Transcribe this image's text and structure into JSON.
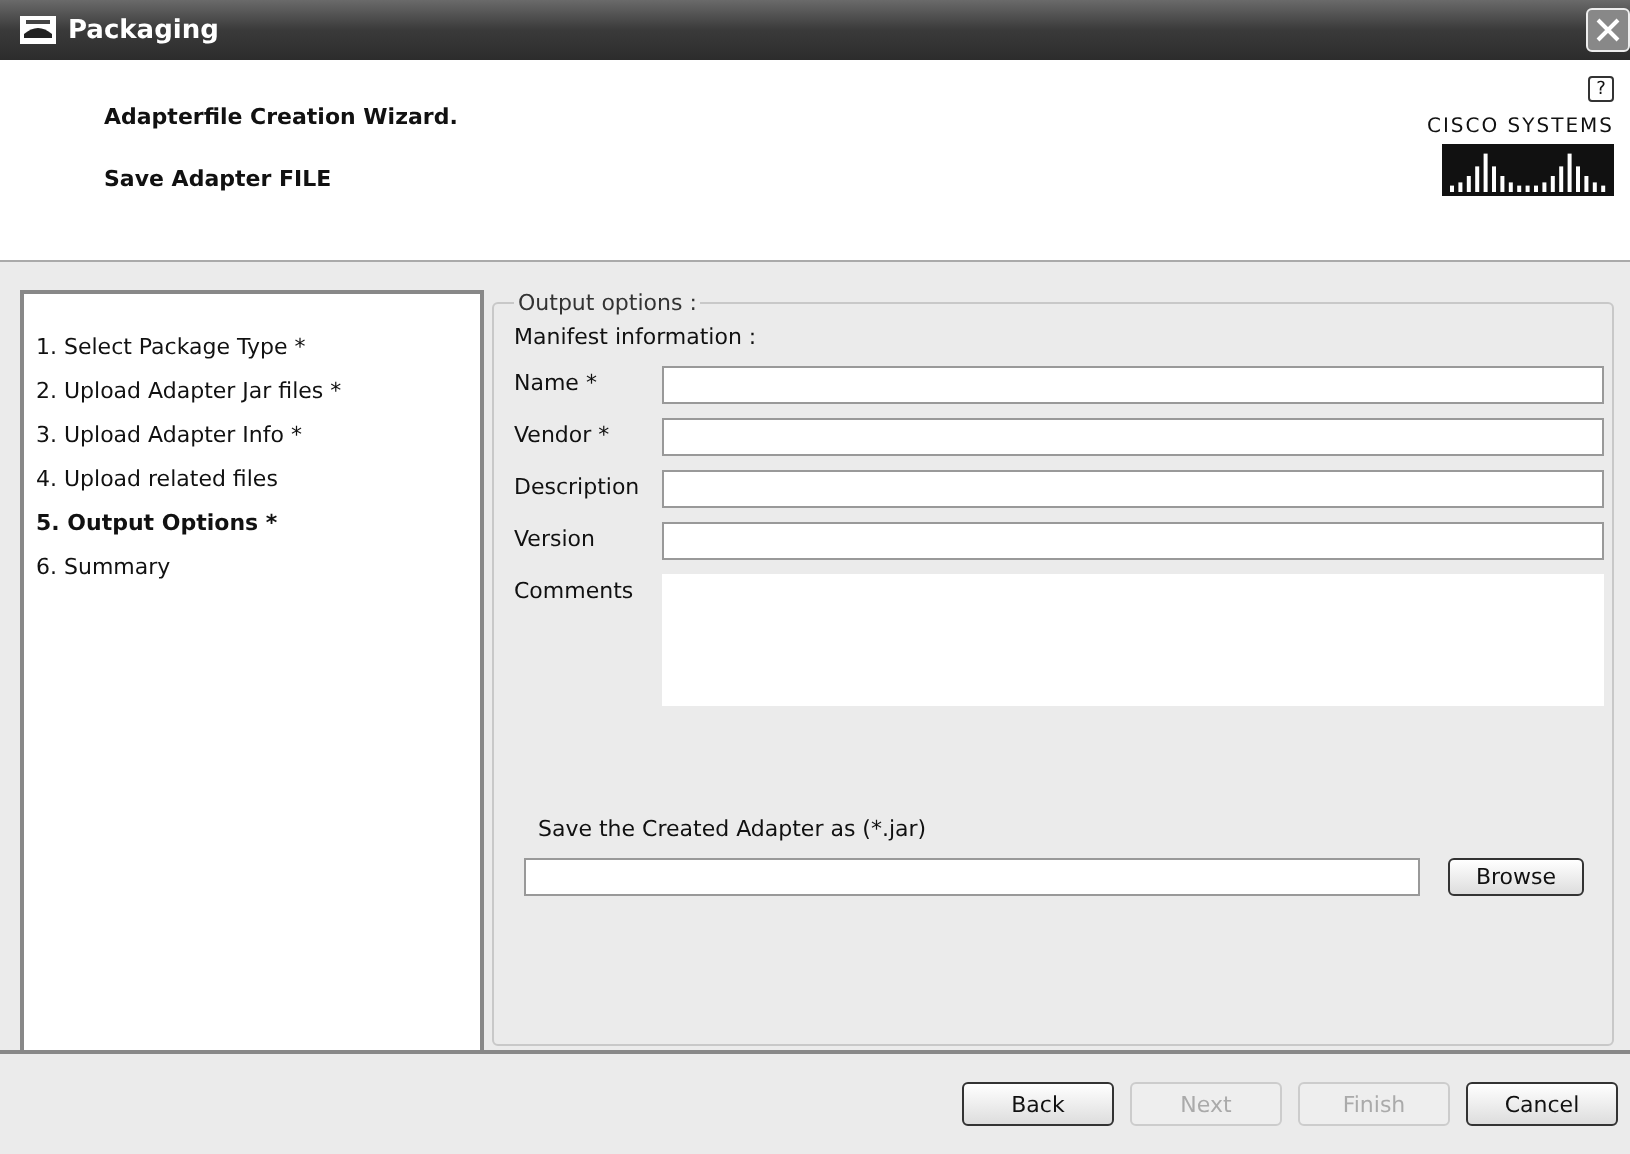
{
  "window": {
    "title": "Packaging"
  },
  "header": {
    "title": "Adapterfile Creation Wizard.",
    "subtitle": "Save Adapter FILE",
    "help": "?",
    "brand": "CISCO SYSTEMS"
  },
  "steps": [
    {
      "label": "1. Select Package Type *",
      "selected": false
    },
    {
      "label": "2. Upload Adapter Jar files *",
      "selected": false
    },
    {
      "label": "3. Upload Adapter Info *",
      "selected": false
    },
    {
      "label": "4. Upload related files",
      "selected": false
    },
    {
      "label": "5. Output Options *",
      "selected": true
    },
    {
      "label": "6. Summary",
      "selected": false
    }
  ],
  "output_options": {
    "legend": "Output options :",
    "section": "Manifest information :",
    "fields": [
      {
        "label": "Name *",
        "kind": "line"
      },
      {
        "label": "Vendor *",
        "kind": "line"
      },
      {
        "label": "Description",
        "kind": "line"
      },
      {
        "label": "Version",
        "kind": "line"
      },
      {
        "label": "Comments",
        "kind": "area"
      }
    ],
    "save_label": "Save the Created Adapter as (*.jar)",
    "browse": {
      "label": "Browse"
    }
  },
  "buttons": [
    {
      "label": "Back",
      "disabled": false
    },
    {
      "label": "Next",
      "disabled": true
    },
    {
      "label": "Finish",
      "disabled": true
    },
    {
      "label": "Cancel",
      "disabled": false
    }
  ]
}
